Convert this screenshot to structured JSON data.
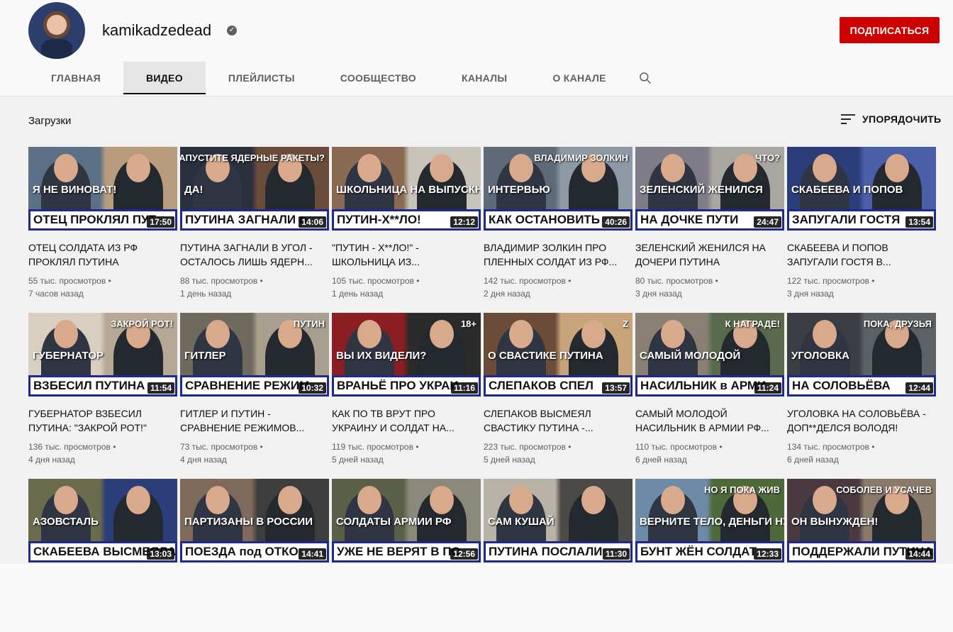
{
  "channel": {
    "name": "kamikadzedead",
    "verified_mark": "✓",
    "subscribe_label": "ПОДПИСАТЬСЯ"
  },
  "tabs": [
    {
      "label": "ГЛАВНАЯ"
    },
    {
      "label": "ВИДЕО"
    },
    {
      "label": "ПЛЕЙЛИСТЫ"
    },
    {
      "label": "СООБЩЕСТВО"
    },
    {
      "label": "КАНАЛЫ"
    },
    {
      "label": "О КАНАЛЕ"
    }
  ],
  "section": {
    "title": "Загрузки",
    "sort_label": "УПОРЯДОЧИТЬ"
  },
  "colors": {
    "accent": "#cc0000",
    "banner_border": "#1e2a8a"
  },
  "videos": [
    {
      "title": "ОТЕЦ СОЛДАТА ИЗ РФ ПРОКЛЯЛ ПУТИНА",
      "views": "55 тыс. просмотров •",
      "age": "7 часов назад",
      "duration": "17:50",
      "banner": "ОТЕЦ ПРОКЛЯЛ ПУТ",
      "overlay": "Я НЕ ВИНОВАТ!",
      "overlay2": "",
      "bg": "#5b6f86",
      "bg2": "#b99c7d"
    },
    {
      "title": "ПУТИНА ЗАГНАЛИ В УГОЛ - ОСТАЛОСЬ ЛИШЬ ЯДЕРН...",
      "views": "88 тыс. просмотров •",
      "age": "1 день назад",
      "duration": "14:06",
      "banner": "ПУТИНА ЗАГНАЛИ в",
      "overlay": "ДА!",
      "overlay2": "ЗАПУСТИТЕ ЯДЕРНЫЕ РАКЕТЫ?",
      "bg": "#2a2f3d",
      "bg2": "#6b4b3a"
    },
    {
      "title": "\"ПУТИН - Х**ЛО!\" - ШКОЛЬНИЦА ИЗ...",
      "views": "105 тыс. просмотров •",
      "age": "1 день назад",
      "duration": "12:12",
      "banner": "ПУТИН-Х**ЛО!",
      "overlay": "ШКОЛЬНИЦА НА ВЫПУСКНОМ:",
      "overlay2": "",
      "bg": "#8a6a52",
      "bg2": "#c9c4bb"
    },
    {
      "title": "ВЛАДИМИР ЗОЛКИН ПРО ПЛЕННЫХ СОЛДАТ ИЗ РФ...",
      "views": "142 тыс. просмотров •",
      "age": "2 дня назад",
      "duration": "40:26",
      "banner": "КАК ОСТАНОВИТЬ",
      "overlay": "ИНТЕРВЬЮ",
      "overlay2": "ВЛАДИМИР ЗОЛКИН",
      "bg": "#5d6b78",
      "bg2": "#8d9aa5"
    },
    {
      "title": "ЗЕЛЕНСКИЙ ЖЕНИЛСЯ НА ДОЧЕРИ ПУТИНА",
      "views": "80 тыс. просмотров •",
      "age": "3 дня назад",
      "duration": "24:47",
      "banner": "НА ДОЧКЕ ПУТИ",
      "overlay": "ЗЕЛЕНСКИЙ ЖЕНИЛСЯ",
      "overlay2": "ЧТО?",
      "bg": "#7e7c86",
      "bg2": "#a9a5a0"
    },
    {
      "title": "СКАБЕЕВА И ПОПОВ ЗАПУГАЛИ ГОСТЯ В...",
      "views": "122 тыс. просмотров •",
      "age": "3 дня назад",
      "duration": "13:54",
      "banner": "ЗАПУГАЛИ ГОСТЯ",
      "overlay": "СКАБЕЕВА И ПОПОВ",
      "overlay2": "",
      "bg": "#2c3e7a",
      "bg2": "#4b5fa8"
    },
    {
      "title": "ГУБЕРНАТОР ВЗБЕСИЛ ПУТИНА: \"ЗАКРОЙ РОТ!\"",
      "views": "136 тыс. просмотров •",
      "age": "4 дня назад",
      "duration": "11:54",
      "banner": "ВЗБЕСИЛ ПУТИНА",
      "overlay": "ГУБЕРНАТОР",
      "overlay2": "ЗАКРОЙ РОТ!",
      "bg": "#d9cfc0",
      "bg2": "#b5a996"
    },
    {
      "title": "ГИТЛЕР И ПУТИН - СРАВНЕНИЕ РЕЖИМОВ...",
      "views": "73 тыс. просмотров •",
      "age": "4 дня назад",
      "duration": "10:32",
      "banner": "СРАВНЕНИЕ РЕЖИМ",
      "overlay": "ГИТЛЕР",
      "overlay2": "ПУТИН",
      "bg": "#6e6a5e",
      "bg2": "#a89f8e"
    },
    {
      "title": "КАК ПО ТВ ВРУТ ПРО УКРАИНУ И СОЛДАТ НА...",
      "views": "119 тыс. просмотров •",
      "age": "5 дней назад",
      "duration": "11:16",
      "banner": "ВРАНЬЁ ПРО УКРАИ",
      "overlay": "ВЫ ИХ ВИДЕЛИ?",
      "overlay2": "18+",
      "bg": "#8a1e22",
      "bg2": "#2b2b2b"
    },
    {
      "title": "СЛЕПАКОВ ВЫСМЕЯЛ СВАСТИКУ ПУТИНА -...",
      "views": "223 тыс. просмотров •",
      "age": "5 дней назад",
      "duration": "13:57",
      "banner": "СЛЕПАКОВ СПЕЛ",
      "overlay": "О СВАСТИКЕ ПУТИНА",
      "overlay2": "Z",
      "bg": "#6b4c38",
      "bg2": "#c8a47a"
    },
    {
      "title": "САМЫЙ МОЛОДОЙ НАСИЛЬНИК В АРМИИ РФ...",
      "views": "110 тыс. просмотров •",
      "age": "6 дней назад",
      "duration": "11:24",
      "banner": "НАСИЛЬНИК в АРМИ",
      "overlay": "САМЫЙ МОЛОДОЙ",
      "overlay2": "К НАГРАДЕ!",
      "bg": "#8a7f73",
      "bg2": "#5a6a4c"
    },
    {
      "title": "УГОЛОВКА НА СОЛОВЬЁВА - ДОП**ДЕЛСЯ ВОЛОДЯ!",
      "views": "134 тыс. просмотров •",
      "age": "6 дней назад",
      "duration": "12:44",
      "banner": "НА СОЛОВЬЁВА",
      "overlay": "УГОЛОВКА",
      "overlay2": "ПОКА, ДРУЗЬЯ",
      "bg": "#3a3d42",
      "bg2": "#5c6067"
    },
    {
      "title": "",
      "views": "",
      "age": "",
      "duration": "13:03",
      "banner": "СКАБЕЕВА ВЫСМЕЯЛА ПУТ",
      "overlay": "АЗОВСТАЛЬ",
      "overlay2": "",
      "bg": "#6b6b4e",
      "bg2": "#2c3e7a"
    },
    {
      "title": "",
      "views": "",
      "age": "",
      "duration": "14:41",
      "banner": "ПОЕЗДА под ОТКО",
      "overlay": "ПАРТИЗАНЫ В РОССИИ",
      "overlay2": "",
      "bg": "#7d6a5a",
      "bg2": "#3d3d3d"
    },
    {
      "title": "",
      "views": "",
      "age": "",
      "duration": "12:56",
      "banner": "УЖЕ НЕ ВЕРЯТ В ПО",
      "overlay": "СОЛДАТЫ АРМИИ РФ",
      "overlay2": "",
      "bg": "#5a5f48",
      "bg2": "#8b8a7a"
    },
    {
      "title": "",
      "views": "",
      "age": "",
      "duration": "11:30",
      "banner": "ПУТИНА ПОСЛАЛИ",
      "overlay": "САМ КУШАЙ",
      "overlay2": "",
      "bg": "#b9b2a6",
      "bg2": "#4c4a47"
    },
    {
      "title": "",
      "views": "",
      "age": "",
      "duration": "12:33",
      "banner": "БУНТ ЖЁН СОЛДАТ",
      "overlay": "ВЕРНИТЕ ТЕЛО, ДЕНЬГИ НУЖНЫ",
      "overlay2": "НО Я ПОКА ЖИВ",
      "bg": "#6d8aa6",
      "bg2": "#4f6a3a"
    },
    {
      "title": "",
      "views": "",
      "age": "",
      "duration": "14:44",
      "banner": "ПОДДЕРЖАЛИ ПУТИНА",
      "overlay": "ОН ВЫНУЖДЕН!",
      "overlay2": "СОБОЛЕВ И УСАЧЕВ",
      "bg": "#4a3a40",
      "bg2": "#8a7a6a"
    }
  ]
}
